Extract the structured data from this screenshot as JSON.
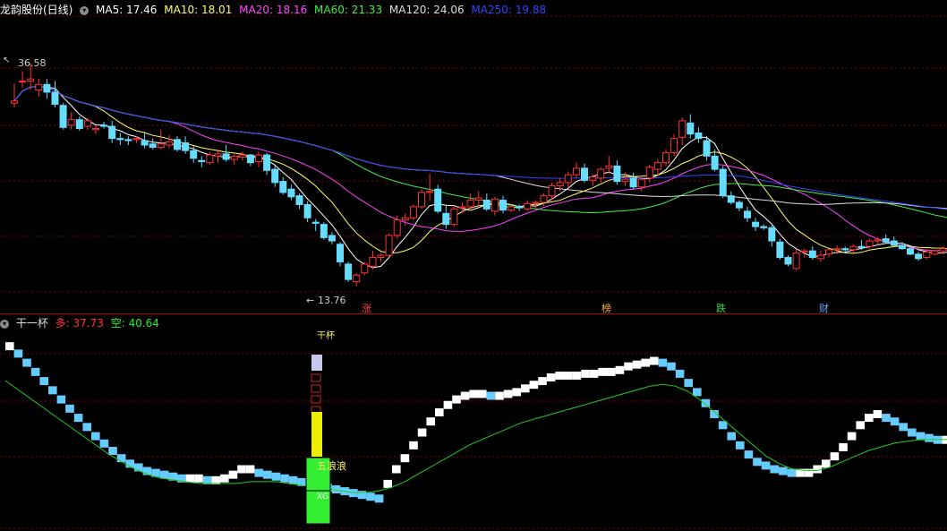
{
  "stock": {
    "title": "龙韵股份(日线)",
    "ma_labels": [
      {
        "key": "ma5",
        "text": "MA5: 17.46",
        "color": "#ffffff"
      },
      {
        "key": "ma10",
        "text": "MA10: 18.01",
        "color": "#ffff66"
      },
      {
        "key": "ma20",
        "text": "MA20: 18.16",
        "color": "#ff44ff"
      },
      {
        "key": "ma60",
        "text": "MA60: 21.33",
        "color": "#44ee44"
      },
      {
        "key": "ma120",
        "text": "MA120: 24.06",
        "color": "#dddddd"
      },
      {
        "key": "ma250",
        "text": "MA250: 19.88",
        "color": "#3344ff"
      }
    ],
    "high_label": "36.58",
    "low_label": "13.76",
    "event_tags": [
      {
        "text": "涨",
        "color": "#ff4444"
      },
      {
        "text": "榜",
        "color": "#ffaa33"
      },
      {
        "text": "跌",
        "color": "#33dd33"
      },
      {
        "text": "财",
        "color": "#66aaff"
      }
    ]
  },
  "indicator": {
    "name": "干一杯",
    "long_label": "多: 37.73",
    "short_label": "空: 40.64",
    "signal_top": "干杯",
    "signal_middle": "五浪浪",
    "signal_bottom": "XG"
  },
  "colors": {
    "up": "#ff3333",
    "down": "#66ddff",
    "grid": "#880000",
    "ind_up": "#ffffff",
    "ind_down": "#66ccff",
    "ind_line": "#22cc22"
  },
  "chart_data": [
    {
      "type": "candlestick",
      "title": "龙韵股份(日线)",
      "ylim": [
        12.5,
        38.5
      ],
      "candles": [
        [
          30.6,
          32.4,
          30.2,
          30.8
        ],
        [
          32.6,
          33.5,
          32.0,
          32.6
        ],
        [
          32.6,
          34.2,
          31.8,
          32.8
        ],
        [
          31.8,
          32.8,
          31.2,
          32.3
        ],
        [
          32.3,
          32.8,
          31.0,
          31.6
        ],
        [
          31.6,
          32.6,
          30.2,
          30.5
        ],
        [
          30.4,
          30.6,
          28.2,
          28.4
        ],
        [
          28.6,
          29.8,
          28.2,
          29.1
        ],
        [
          29.1,
          29.4,
          28.1,
          28.3
        ],
        [
          28.5,
          29.3,
          28.2,
          29.0
        ],
        [
          28.2,
          28.6,
          27.8,
          28.3
        ],
        [
          28.6,
          28.9,
          28.3,
          28.5
        ],
        [
          28.5,
          29.0,
          27.0,
          27.4
        ],
        [
          27.4,
          27.9,
          26.8,
          27.3
        ],
        [
          27.3,
          27.6,
          26.8,
          27.2
        ],
        [
          27.3,
          27.6,
          27.0,
          27.4
        ],
        [
          27.2,
          27.9,
          26.5,
          26.8
        ],
        [
          26.9,
          27.4,
          26.4,
          26.6
        ],
        [
          26.6,
          28.2,
          26.4,
          26.9
        ],
        [
          26.8,
          27.7,
          26.5,
          27.1
        ],
        [
          27.3,
          27.6,
          26.2,
          26.4
        ],
        [
          27.0,
          27.6,
          26.0,
          26.3
        ],
        [
          26.3,
          26.7,
          25.2,
          25.6
        ],
        [
          25.4,
          25.8,
          24.8,
          25.3
        ],
        [
          25.2,
          26.2,
          25.0,
          25.9
        ],
        [
          25.8,
          26.4,
          25.2,
          26.0
        ],
        [
          26.0,
          26.8,
          25.3,
          25.5
        ],
        [
          25.5,
          26.1,
          25.0,
          25.8
        ],
        [
          25.7,
          26.2,
          25.4,
          25.9
        ],
        [
          25.9,
          26.0,
          24.9,
          25.2
        ],
        [
          25.3,
          26.2,
          24.8,
          25.9
        ],
        [
          25.9,
          26.1,
          24.1,
          24.5
        ],
        [
          24.6,
          24.9,
          23.0,
          23.4
        ],
        [
          23.5,
          23.9,
          22.3,
          22.5
        ],
        [
          22.8,
          23.2,
          21.8,
          22.1
        ],
        [
          22.2,
          22.4,
          21.0,
          21.4
        ],
        [
          21.4,
          21.7,
          19.8,
          20.2
        ],
        [
          19.8,
          20.1,
          19.0,
          19.7
        ],
        [
          19.6,
          19.8,
          18.2,
          18.4
        ],
        [
          18.6,
          18.9,
          17.8,
          18.1
        ],
        [
          17.8,
          18.0,
          15.8,
          16.2
        ],
        [
          16.0,
          16.2,
          14.4,
          14.6
        ],
        [
          14.4,
          15.2,
          14.0,
          15.0
        ],
        [
          15.2,
          16.2,
          15.0,
          16.0
        ],
        [
          15.8,
          17.2,
          15.5,
          16.6
        ],
        [
          16.6,
          17.0,
          16.2,
          16.8
        ],
        [
          16.8,
          18.8,
          16.6,
          18.6
        ],
        [
          18.6,
          20.4,
          18.3,
          20.0
        ],
        [
          20.0,
          20.6,
          19.5,
          20.2
        ],
        [
          20.2,
          21.4,
          20.0,
          21.2
        ],
        [
          21.2,
          22.8,
          21.0,
          22.5
        ],
        [
          22.5,
          24.2,
          21.8,
          22.6
        ],
        [
          22.8,
          23.2,
          20.6,
          20.8
        ],
        [
          20.6,
          21.4,
          19.2,
          19.6
        ],
        [
          19.6,
          21.2,
          19.4,
          21.0
        ],
        [
          21.1,
          21.6,
          20.6,
          21.2
        ],
        [
          21.2,
          22.4,
          20.8,
          21.8
        ],
        [
          21.8,
          22.6,
          21.2,
          22.0
        ],
        [
          21.8,
          22.4,
          20.8,
          21.0
        ],
        [
          20.8,
          22.1,
          20.4,
          21.9
        ],
        [
          21.8,
          22.2,
          20.6,
          20.9
        ],
        [
          20.9,
          21.4,
          20.7,
          21.2
        ],
        [
          21.2,
          21.4,
          20.8,
          21.1
        ],
        [
          21.0,
          21.8,
          20.8,
          21.5
        ],
        [
          21.5,
          21.8,
          21.0,
          21.6
        ],
        [
          21.6,
          22.4,
          21.3,
          22.2
        ],
        [
          22.2,
          23.4,
          21.8,
          23.1
        ],
        [
          23.1,
          23.8,
          22.6,
          23.4
        ],
        [
          23.4,
          24.4,
          22.9,
          24.1
        ],
        [
          24.1,
          25.2,
          23.8,
          24.7
        ],
        [
          24.7,
          25.1,
          23.4,
          23.6
        ],
        [
          23.6,
          24.2,
          23.1,
          23.9
        ],
        [
          23.8,
          24.8,
          23.4,
          24.6
        ],
        [
          24.7,
          25.8,
          24.2,
          24.9
        ],
        [
          24.9,
          25.4,
          23.2,
          23.5
        ],
        [
          23.5,
          24.3,
          23.1,
          23.7
        ],
        [
          23.8,
          24.3,
          22.8,
          23.0
        ],
        [
          23.0,
          23.9,
          22.6,
          23.7
        ],
        [
          23.8,
          25.0,
          23.4,
          24.8
        ],
        [
          24.6,
          25.5,
          24.0,
          25.2
        ],
        [
          25.2,
          26.4,
          24.9,
          26.1
        ],
        [
          26.1,
          27.8,
          25.8,
          27.4
        ],
        [
          27.5,
          29.3,
          26.8,
          29.0
        ],
        [
          28.8,
          29.6,
          27.4,
          27.8
        ],
        [
          27.9,
          28.4,
          27.0,
          27.4
        ],
        [
          27.2,
          27.6,
          25.4,
          25.8
        ],
        [
          25.8,
          26.4,
          24.4,
          24.6
        ],
        [
          24.6,
          24.9,
          22.0,
          22.2
        ],
        [
          22.2,
          22.6,
          21.4,
          21.6
        ],
        [
          21.6,
          21.8,
          20.8,
          21.1
        ],
        [
          20.8,
          21.2,
          19.8,
          20.2
        ],
        [
          19.8,
          20.2,
          19.0,
          19.4
        ],
        [
          19.4,
          19.6,
          19.1,
          19.3
        ],
        [
          19.3,
          19.5,
          17.6,
          18.1
        ],
        [
          18.0,
          18.3,
          16.4,
          16.6
        ],
        [
          16.6,
          16.8,
          15.8,
          16.0
        ],
        [
          15.6,
          17.4,
          15.4,
          17.0
        ],
        [
          17.1,
          17.4,
          16.6,
          17.2
        ],
        [
          17.2,
          17.6,
          16.4,
          16.6
        ],
        [
          16.5,
          17.2,
          16.2,
          16.8
        ],
        [
          16.9,
          17.4,
          16.6,
          17.3
        ],
        [
          17.3,
          17.7,
          16.9,
          17.4
        ],
        [
          17.4,
          17.6,
          17.1,
          17.3
        ],
        [
          17.3,
          17.8,
          17.0,
          17.6
        ],
        [
          17.6,
          18.2,
          17.3,
          17.5
        ],
        [
          17.6,
          18.3,
          17.4,
          18.1
        ],
        [
          18.1,
          18.4,
          17.7,
          18.2
        ],
        [
          18.3,
          18.7,
          17.9,
          18.0
        ],
        [
          18.1,
          18.5,
          17.6,
          17.7
        ],
        [
          17.7,
          18.0,
          17.3,
          17.4
        ],
        [
          17.4,
          17.6,
          16.8,
          16.9
        ],
        [
          16.9,
          17.1,
          16.3,
          16.5
        ],
        [
          16.6,
          17.4,
          16.4,
          17.1
        ],
        [
          16.9,
          17.3,
          16.8,
          17.2
        ],
        [
          17.2,
          17.6,
          16.9,
          17.4
        ],
        [
          17.4,
          17.8,
          17.1,
          17.4
        ]
      ],
      "high_label": "36.58",
      "low_label": "13.76"
    },
    {
      "type": "step",
      "title": "干一杯",
      "ylim": [
        0,
        1
      ],
      "series": [
        {
          "name": "多",
          "values": [
            0.97,
            0.93,
            0.88,
            0.83,
            0.78,
            0.73,
            0.68,
            0.63,
            0.58,
            0.53,
            0.48,
            0.44,
            0.4,
            0.36,
            0.33,
            0.31,
            0.29,
            0.28,
            0.27,
            0.26,
            0.25,
            0.25,
            0.25,
            0.24,
            0.24,
            0.25,
            0.27,
            0.3,
            0.3,
            0.28,
            0.27,
            0.26,
            0.25,
            0.24,
            0.23,
            0.22,
            0.21,
            0.2,
            0.19,
            0.18,
            0.17,
            0.16,
            0.15,
            0.14,
            0.22,
            0.3,
            0.36,
            0.43,
            0.5,
            0.56,
            0.61,
            0.65,
            0.68,
            0.7,
            0.71,
            0.71,
            0.7,
            0.7,
            0.71,
            0.72,
            0.74,
            0.76,
            0.78,
            0.8,
            0.81,
            0.81,
            0.81,
            0.82,
            0.82,
            0.83,
            0.83,
            0.84,
            0.86,
            0.87,
            0.88,
            0.89,
            0.88,
            0.86,
            0.82,
            0.77,
            0.72,
            0.66,
            0.6,
            0.54,
            0.48,
            0.43,
            0.38,
            0.34,
            0.32,
            0.3,
            0.29,
            0.28,
            0.28,
            0.28,
            0.3,
            0.33,
            0.37,
            0.42,
            0.48,
            0.54,
            0.58,
            0.6,
            0.58,
            0.56,
            0.53,
            0.5,
            0.48,
            0.47,
            0.46,
            0.46,
            0.45
          ]
        },
        {
          "name": "空",
          "values": [
            0.78,
            0.73,
            0.68,
            0.63,
            0.58,
            0.53,
            0.48,
            0.43,
            0.38,
            0.34,
            0.3,
            0.27,
            0.25,
            0.24,
            0.23,
            0.22,
            0.22,
            0.22,
            0.22,
            0.23,
            0.23,
            0.23,
            0.22,
            0.21,
            0.2,
            0.19,
            0.18,
            0.17,
            0.17,
            0.18,
            0.2,
            0.23,
            0.27,
            0.31,
            0.35,
            0.39,
            0.43,
            0.46,
            0.49,
            0.52,
            0.55,
            0.57,
            0.59,
            0.61,
            0.63,
            0.65,
            0.67,
            0.69,
            0.71,
            0.73,
            0.75,
            0.76,
            0.75,
            0.72,
            0.67,
            0.61,
            0.55,
            0.49,
            0.43,
            0.37,
            0.33,
            0.3,
            0.29,
            0.29,
            0.31,
            0.34,
            0.37,
            0.4,
            0.42,
            0.44,
            0.45,
            0.46,
            0.46,
            0.46,
            0.45
          ]
        }
      ]
    }
  ]
}
